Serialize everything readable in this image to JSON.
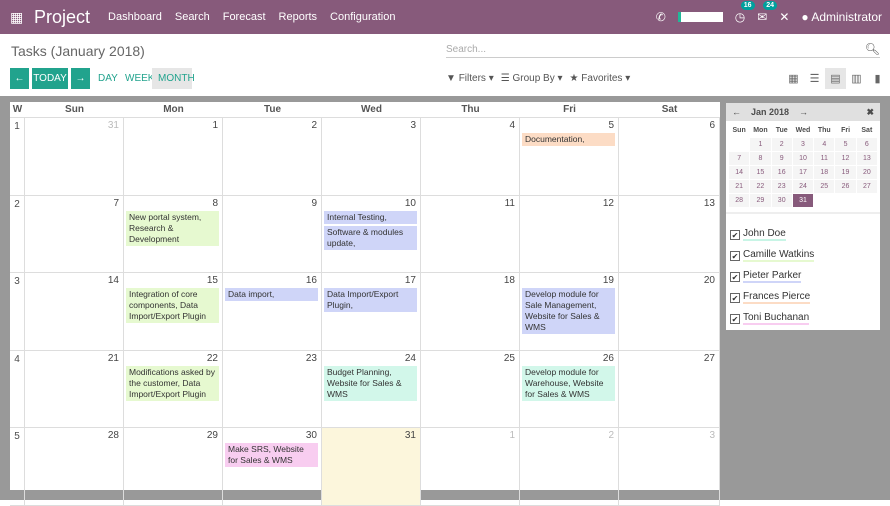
{
  "topbar": {
    "app": "Project",
    "menu": [
      "Dashboard",
      "Search",
      "Forecast",
      "Reports",
      "Configuration"
    ],
    "activity_count": "16",
    "message_count": "24",
    "user": "Administrator"
  },
  "page": {
    "title": "Tasks (January 2018)",
    "search_placeholder": "Search..."
  },
  "controls": {
    "today": "TODAY",
    "day": "DAY",
    "week": "WEEK",
    "month": "MONTH",
    "filters": "Filters",
    "group_by": "Group By",
    "favorites": "Favorites"
  },
  "calendar": {
    "week_header": "W",
    "days": [
      "Sun",
      "Mon",
      "Tue",
      "Wed",
      "Thu",
      "Fri",
      "Sat"
    ],
    "weeks": [
      {
        "n": "1",
        "dates": [
          "31",
          "1",
          "2",
          "3",
          "4",
          "5",
          "6"
        ],
        "other": [
          0
        ]
      },
      {
        "n": "2",
        "dates": [
          "7",
          "8",
          "9",
          "10",
          "11",
          "12",
          "13"
        ],
        "other": []
      },
      {
        "n": "3",
        "dates": [
          "14",
          "15",
          "16",
          "17",
          "18",
          "19",
          "20"
        ],
        "other": []
      },
      {
        "n": "4",
        "dates": [
          "21",
          "22",
          "23",
          "24",
          "25",
          "26",
          "27"
        ],
        "other": []
      },
      {
        "n": "5",
        "dates": [
          "28",
          "29",
          "30",
          "31",
          "1",
          "2",
          "3"
        ],
        "other": [
          4,
          5,
          6
        ],
        "today": 3
      }
    ],
    "events": [
      {
        "week": 0,
        "day": 5,
        "text": "Documentation,",
        "color": "#fcdcc5"
      },
      {
        "week": 1,
        "day": 1,
        "text": "New portal system, Research & Development",
        "color": "#e6f9d0"
      },
      {
        "week": 1,
        "day": 3,
        "text": "Internal Testing,",
        "color": "#cfd5f8"
      },
      {
        "week": 1,
        "day": 3,
        "text": "Software & modules update,",
        "color": "#cfd5f8",
        "slot": 1
      },
      {
        "week": 2,
        "day": 1,
        "text": "Integration of core components, Data Import/Export Plugin",
        "color": "#e6f9d0"
      },
      {
        "week": 2,
        "day": 2,
        "text": "Data import,",
        "color": "#cfd5f8"
      },
      {
        "week": 2,
        "day": 3,
        "text": "Data Import/Export Plugin,",
        "color": "#cfd5f8"
      },
      {
        "week": 2,
        "day": 5,
        "text": "Develop module for Sale Management, Website for Sales & WMS",
        "color": "#cfd5f8"
      },
      {
        "week": 3,
        "day": 1,
        "text": "Modifications asked by the customer, Data Import/Export Plugin",
        "color": "#e6f9d0"
      },
      {
        "week": 3,
        "day": 3,
        "text": "Budget Planning, Website for Sales & WMS",
        "color": "#d2f7ea"
      },
      {
        "week": 3,
        "day": 5,
        "text": "Develop module for Warehouse, Website for Sales & WMS",
        "color": "#d2f7ea"
      },
      {
        "week": 4,
        "day": 2,
        "text": "Make SRS, Website for Sales & WMS",
        "color": "#f8cdf0"
      }
    ]
  },
  "mini": {
    "title": "Jan 2018",
    "days": [
      "Sun",
      "Mon",
      "Tue",
      "Wed",
      "Thu",
      "Fri",
      "Sat"
    ],
    "dates": [
      "",
      "1",
      "2",
      "3",
      "4",
      "5",
      "6",
      "7",
      "8",
      "9",
      "10",
      "11",
      "12",
      "13",
      "14",
      "15",
      "16",
      "17",
      "18",
      "19",
      "20",
      "21",
      "22",
      "23",
      "24",
      "25",
      "26",
      "27",
      "28",
      "29",
      "30",
      "31"
    ],
    "selected": "31"
  },
  "attendees": [
    {
      "name": "John Doe",
      "color": "#c8f5e6"
    },
    {
      "name": "Camille Watkins",
      "color": "#e6f9d0"
    },
    {
      "name": "Pieter Parker",
      "color": "#cfd5f8"
    },
    {
      "name": "Frances Pierce",
      "color": "#fcdcc5"
    },
    {
      "name": "Toni Buchanan",
      "color": "#f8cdf0"
    }
  ]
}
